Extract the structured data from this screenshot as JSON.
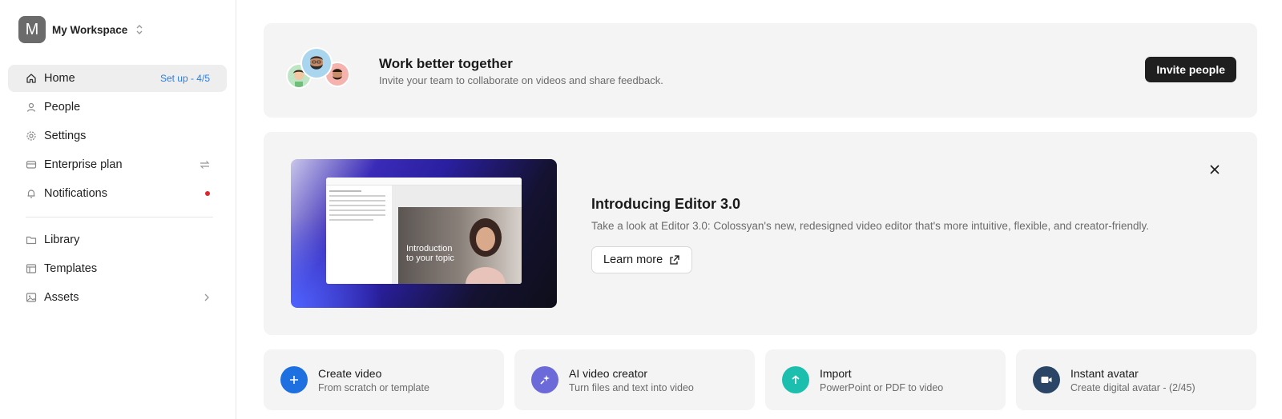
{
  "workspace": {
    "initial": "M",
    "name": "My Workspace"
  },
  "sidebar": {
    "items": [
      {
        "label": "Home",
        "badge": "Set up - 4/5"
      },
      {
        "label": "People"
      },
      {
        "label": "Settings"
      },
      {
        "label": "Enterprise plan"
      },
      {
        "label": "Notifications"
      },
      {
        "label": "Library"
      },
      {
        "label": "Templates"
      },
      {
        "label": "Assets"
      }
    ]
  },
  "collab": {
    "title": "Work better together",
    "subtitle": "Invite your team to collaborate on videos and share feedback.",
    "button": "Invite people"
  },
  "promo": {
    "title": "Introducing Editor 3.0",
    "subtitle": "Take a look at Editor 3.0: Colossyan's new, redesigned video editor that's more intuitive, flexible, and creator-friendly.",
    "button": "Learn more",
    "thumb_caption_line1": "Introduction",
    "thumb_caption_line2": "to your topic"
  },
  "actions": [
    {
      "title": "Create video",
      "subtitle": "From scratch or template",
      "color": "#1e6fe0",
      "icon": "plus-icon"
    },
    {
      "title": "AI video creator",
      "subtitle": "Turn files and text into video",
      "color": "#6c6ad8",
      "icon": "sparkle-icon"
    },
    {
      "title": "Import",
      "subtitle": "PowerPoint or PDF to video",
      "color": "#1cbfae",
      "icon": "arrow-up-icon"
    },
    {
      "title": "Instant avatar",
      "subtitle": "Create digital avatar - (2/45)",
      "color": "#2a4566",
      "icon": "video-camera-icon"
    }
  ],
  "colors": {
    "accent": "#2f7de1",
    "notification_dot": "#e0252f",
    "card_bg": "#f4f4f4"
  }
}
